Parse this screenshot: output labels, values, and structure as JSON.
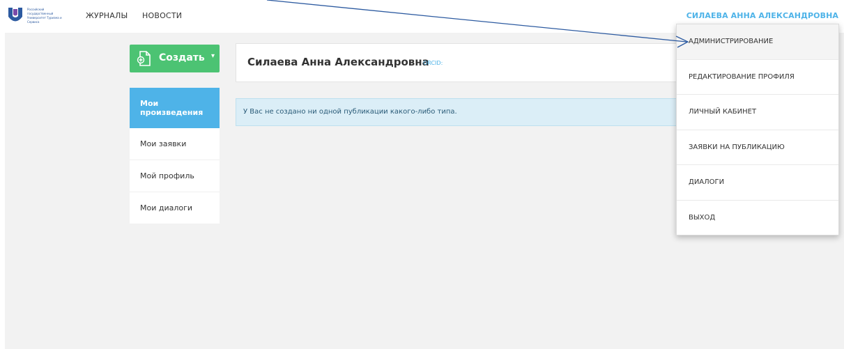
{
  "header": {
    "logo_text": "Российский государственный Университет Туризма и Сервиса",
    "nav": [
      "ЖУРНАЛЫ",
      "НОВОСТИ"
    ],
    "user_name": "СИЛАЕВА АННА АЛЕКСАНДРОВНА"
  },
  "create_button": {
    "label": "Создать",
    "caret": "▾",
    "icon": "document-plus-icon"
  },
  "sidebar": {
    "items": [
      {
        "label": "Мои произведения",
        "active": true
      },
      {
        "label": "Мои заявки",
        "active": false
      },
      {
        "label": "Мой профиль",
        "active": false
      },
      {
        "label": "Мои диалоги",
        "active": false
      }
    ]
  },
  "profile": {
    "name": "Силаева Анна Александровна",
    "orcid_label": "ORCID:"
  },
  "info_message": "У Вас не создано ни одной публикации какого-либо типа.",
  "user_menu": {
    "items": [
      "АДМИНИСТРИРОВАНИЕ",
      "РЕДАКТИРОВАНИЕ ПРОФИЛЯ",
      "ЛИЧНЫЙ КАБИНЕТ",
      "ЗАЯВКИ НА ПУБЛИКАЦИЮ",
      "ДИАЛОГИ",
      "ВЫХОД"
    ]
  },
  "colors": {
    "accent": "#4eb3e8",
    "create_green": "#4cc373",
    "page_bg": "#f2f2f2",
    "info_bg": "#dbeef7",
    "arrow": "#2c5aa0"
  }
}
